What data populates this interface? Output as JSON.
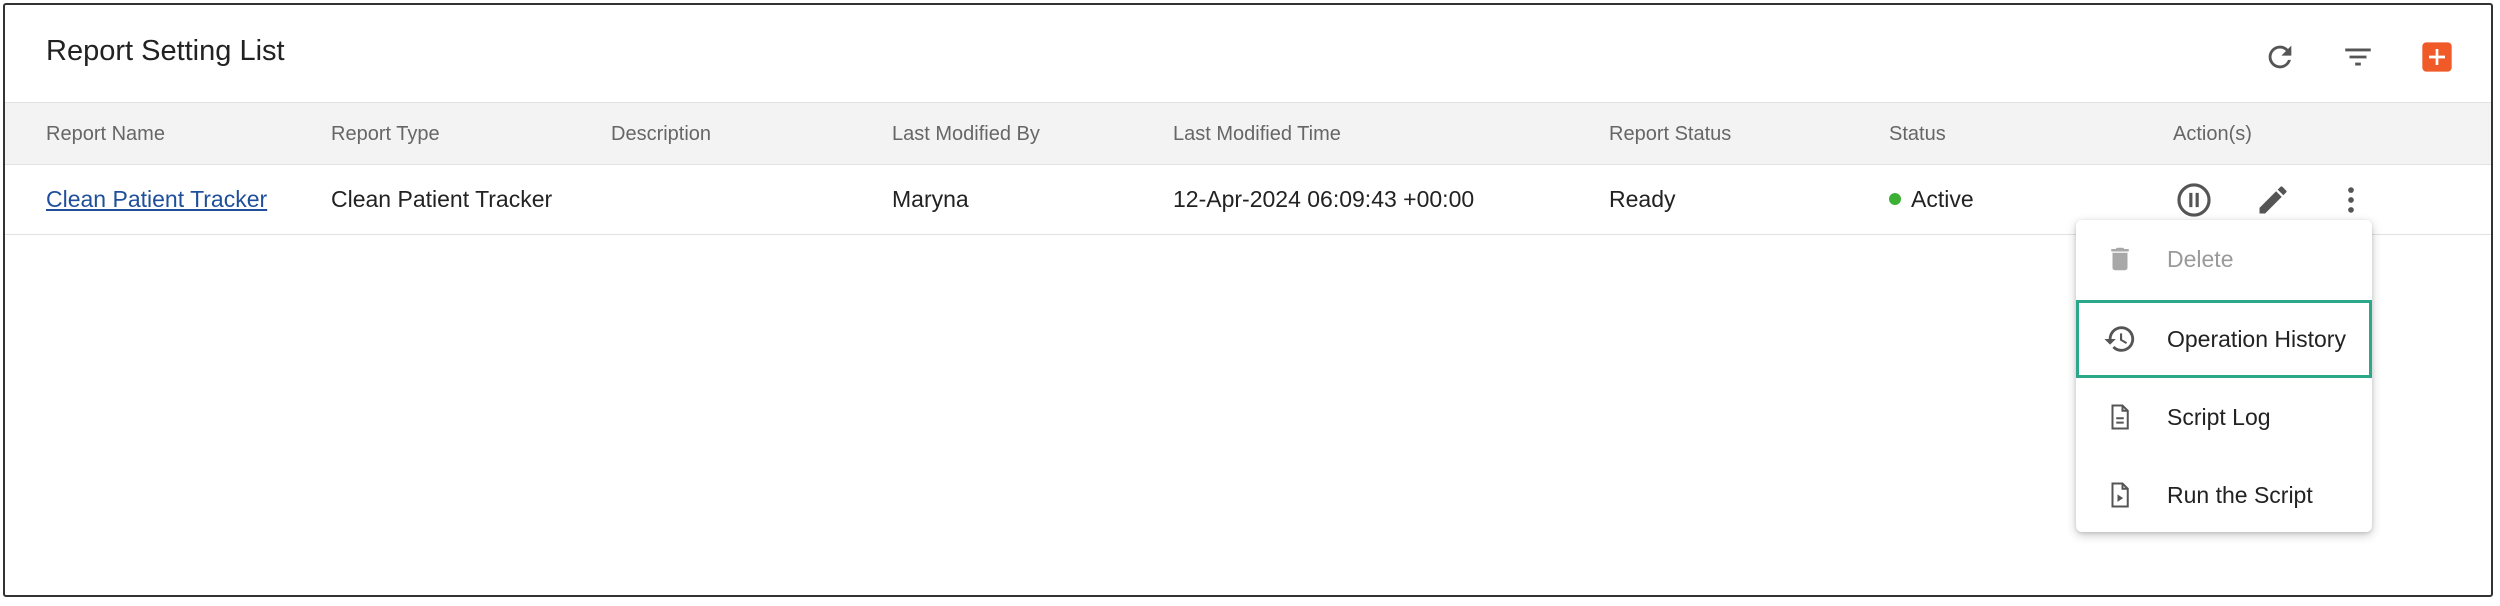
{
  "page": {
    "title": "Report Setting List"
  },
  "header_actions": {
    "refresh_icon": "refresh-icon",
    "filter_icon": "filter-icon",
    "add_icon": "add-icon",
    "add_color": "#f05a28"
  },
  "table": {
    "columns": [
      "Report Name",
      "Report Type",
      "Description",
      "Last Modified By",
      "Last Modified Time",
      "Report Status",
      "Status",
      "Action(s)"
    ],
    "rows": [
      {
        "report_name": "Clean Patient Tracker",
        "report_type": "Clean Patient Tracker",
        "description": "",
        "last_modified_by": "Maryna",
        "last_modified_time": "12-Apr-2024 06:09:43 +00:00",
        "report_status": "Ready",
        "status": "Active",
        "status_color": "#3cb034"
      }
    ]
  },
  "action_menu": {
    "items": [
      {
        "label": "Delete",
        "icon": "trash-icon",
        "disabled": true
      },
      {
        "label": "Operation History",
        "icon": "history-icon",
        "highlighted": true
      },
      {
        "label": "Script Log",
        "icon": "document-icon"
      },
      {
        "label": "Run the Script",
        "icon": "run-file-icon"
      }
    ],
    "highlight_color": "#2aa889"
  }
}
